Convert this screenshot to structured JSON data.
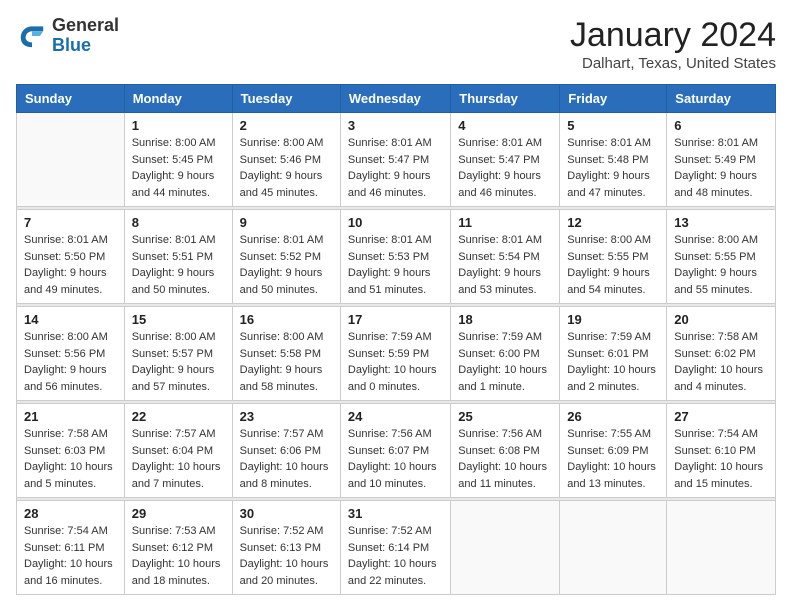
{
  "header": {
    "logo_general": "General",
    "logo_blue": "Blue",
    "main_title": "January 2024",
    "subtitle": "Dalhart, Texas, United States"
  },
  "weekdays": [
    "Sunday",
    "Monday",
    "Tuesday",
    "Wednesday",
    "Thursday",
    "Friday",
    "Saturday"
  ],
  "weeks": [
    [
      {
        "day": "",
        "sunrise": "",
        "sunset": "",
        "daylight": ""
      },
      {
        "day": "1",
        "sunrise": "Sunrise: 8:00 AM",
        "sunset": "Sunset: 5:45 PM",
        "daylight": "Daylight: 9 hours and 44 minutes."
      },
      {
        "day": "2",
        "sunrise": "Sunrise: 8:00 AM",
        "sunset": "Sunset: 5:46 PM",
        "daylight": "Daylight: 9 hours and 45 minutes."
      },
      {
        "day": "3",
        "sunrise": "Sunrise: 8:01 AM",
        "sunset": "Sunset: 5:47 PM",
        "daylight": "Daylight: 9 hours and 46 minutes."
      },
      {
        "day": "4",
        "sunrise": "Sunrise: 8:01 AM",
        "sunset": "Sunset: 5:47 PM",
        "daylight": "Daylight: 9 hours and 46 minutes."
      },
      {
        "day": "5",
        "sunrise": "Sunrise: 8:01 AM",
        "sunset": "Sunset: 5:48 PM",
        "daylight": "Daylight: 9 hours and 47 minutes."
      },
      {
        "day": "6",
        "sunrise": "Sunrise: 8:01 AM",
        "sunset": "Sunset: 5:49 PM",
        "daylight": "Daylight: 9 hours and 48 minutes."
      }
    ],
    [
      {
        "day": "7",
        "sunrise": "Sunrise: 8:01 AM",
        "sunset": "Sunset: 5:50 PM",
        "daylight": "Daylight: 9 hours and 49 minutes."
      },
      {
        "day": "8",
        "sunrise": "Sunrise: 8:01 AM",
        "sunset": "Sunset: 5:51 PM",
        "daylight": "Daylight: 9 hours and 50 minutes."
      },
      {
        "day": "9",
        "sunrise": "Sunrise: 8:01 AM",
        "sunset": "Sunset: 5:52 PM",
        "daylight": "Daylight: 9 hours and 50 minutes."
      },
      {
        "day": "10",
        "sunrise": "Sunrise: 8:01 AM",
        "sunset": "Sunset: 5:53 PM",
        "daylight": "Daylight: 9 hours and 51 minutes."
      },
      {
        "day": "11",
        "sunrise": "Sunrise: 8:01 AM",
        "sunset": "Sunset: 5:54 PM",
        "daylight": "Daylight: 9 hours and 53 minutes."
      },
      {
        "day": "12",
        "sunrise": "Sunrise: 8:00 AM",
        "sunset": "Sunset: 5:55 PM",
        "daylight": "Daylight: 9 hours and 54 minutes."
      },
      {
        "day": "13",
        "sunrise": "Sunrise: 8:00 AM",
        "sunset": "Sunset: 5:55 PM",
        "daylight": "Daylight: 9 hours and 55 minutes."
      }
    ],
    [
      {
        "day": "14",
        "sunrise": "Sunrise: 8:00 AM",
        "sunset": "Sunset: 5:56 PM",
        "daylight": "Daylight: 9 hours and 56 minutes."
      },
      {
        "day": "15",
        "sunrise": "Sunrise: 8:00 AM",
        "sunset": "Sunset: 5:57 PM",
        "daylight": "Daylight: 9 hours and 57 minutes."
      },
      {
        "day": "16",
        "sunrise": "Sunrise: 8:00 AM",
        "sunset": "Sunset: 5:58 PM",
        "daylight": "Daylight: 9 hours and 58 minutes."
      },
      {
        "day": "17",
        "sunrise": "Sunrise: 7:59 AM",
        "sunset": "Sunset: 5:59 PM",
        "daylight": "Daylight: 10 hours and 0 minutes."
      },
      {
        "day": "18",
        "sunrise": "Sunrise: 7:59 AM",
        "sunset": "Sunset: 6:00 PM",
        "daylight": "Daylight: 10 hours and 1 minute."
      },
      {
        "day": "19",
        "sunrise": "Sunrise: 7:59 AM",
        "sunset": "Sunset: 6:01 PM",
        "daylight": "Daylight: 10 hours and 2 minutes."
      },
      {
        "day": "20",
        "sunrise": "Sunrise: 7:58 AM",
        "sunset": "Sunset: 6:02 PM",
        "daylight": "Daylight: 10 hours and 4 minutes."
      }
    ],
    [
      {
        "day": "21",
        "sunrise": "Sunrise: 7:58 AM",
        "sunset": "Sunset: 6:03 PM",
        "daylight": "Daylight: 10 hours and 5 minutes."
      },
      {
        "day": "22",
        "sunrise": "Sunrise: 7:57 AM",
        "sunset": "Sunset: 6:04 PM",
        "daylight": "Daylight: 10 hours and 7 minutes."
      },
      {
        "day": "23",
        "sunrise": "Sunrise: 7:57 AM",
        "sunset": "Sunset: 6:06 PM",
        "daylight": "Daylight: 10 hours and 8 minutes."
      },
      {
        "day": "24",
        "sunrise": "Sunrise: 7:56 AM",
        "sunset": "Sunset: 6:07 PM",
        "daylight": "Daylight: 10 hours and 10 minutes."
      },
      {
        "day": "25",
        "sunrise": "Sunrise: 7:56 AM",
        "sunset": "Sunset: 6:08 PM",
        "daylight": "Daylight: 10 hours and 11 minutes."
      },
      {
        "day": "26",
        "sunrise": "Sunrise: 7:55 AM",
        "sunset": "Sunset: 6:09 PM",
        "daylight": "Daylight: 10 hours and 13 minutes."
      },
      {
        "day": "27",
        "sunrise": "Sunrise: 7:54 AM",
        "sunset": "Sunset: 6:10 PM",
        "daylight": "Daylight: 10 hours and 15 minutes."
      }
    ],
    [
      {
        "day": "28",
        "sunrise": "Sunrise: 7:54 AM",
        "sunset": "Sunset: 6:11 PM",
        "daylight": "Daylight: 10 hours and 16 minutes."
      },
      {
        "day": "29",
        "sunrise": "Sunrise: 7:53 AM",
        "sunset": "Sunset: 6:12 PM",
        "daylight": "Daylight: 10 hours and 18 minutes."
      },
      {
        "day": "30",
        "sunrise": "Sunrise: 7:52 AM",
        "sunset": "Sunset: 6:13 PM",
        "daylight": "Daylight: 10 hours and 20 minutes."
      },
      {
        "day": "31",
        "sunrise": "Sunrise: 7:52 AM",
        "sunset": "Sunset: 6:14 PM",
        "daylight": "Daylight: 10 hours and 22 minutes."
      },
      {
        "day": "",
        "sunrise": "",
        "sunset": "",
        "daylight": ""
      },
      {
        "day": "",
        "sunrise": "",
        "sunset": "",
        "daylight": ""
      },
      {
        "day": "",
        "sunrise": "",
        "sunset": "",
        "daylight": ""
      }
    ]
  ]
}
